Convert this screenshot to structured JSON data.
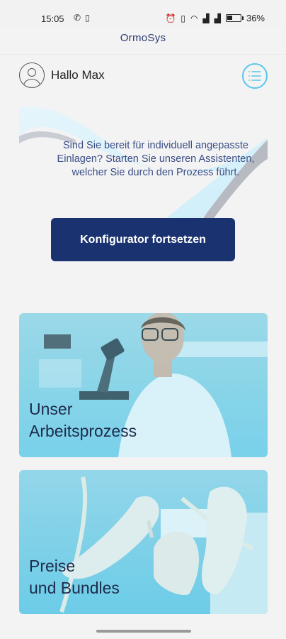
{
  "status_bar": {
    "time": "15:05",
    "left_icons": [
      "whatsapp-icon",
      "notification-icon"
    ],
    "right_icons": [
      "alarm-icon",
      "vibrate-icon",
      "wifi-icon",
      "signal-icon",
      "signal-icon",
      "battery-icon"
    ],
    "battery": "36%"
  },
  "app": {
    "title": "OrmoSys"
  },
  "user": {
    "greeting": "Hallo Max"
  },
  "hero": {
    "text": "Sind Sie bereit für individuell angepasste Einlagen? Starten Sie unseren Assistenten, welcher Sie durch den Prozess führt.",
    "button_label": "Konfigurator fortsetzen"
  },
  "cards": [
    {
      "line1": "Unser",
      "line2": "Arbeitsprozess",
      "image": "scientist-microscope"
    },
    {
      "line1": "Preise",
      "line2": "und Bundles",
      "image": "white-high-heels"
    }
  ],
  "colors": {
    "accent": "#58c7e8",
    "primary_button": "#1b3270",
    "card_tint": "#7fd6ee"
  }
}
